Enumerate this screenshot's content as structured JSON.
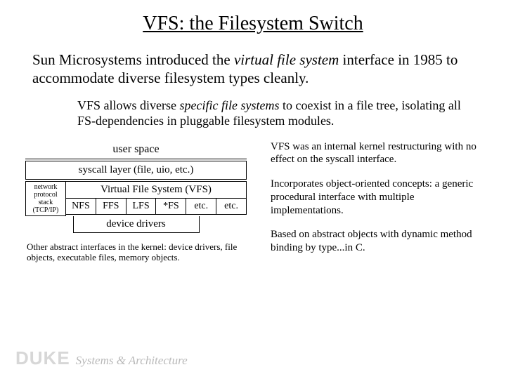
{
  "title": "VFS: the Filesystem Switch",
  "intro_a": "Sun Microsystems introduced the ",
  "intro_em": "virtual file system",
  "intro_b": " interface in 1985 to accommodate diverse filesystem types cleanly.",
  "sub_a": "VFS allows diverse ",
  "sub_em": "specific file systems",
  "sub_b": " to coexist in a file tree, isolating all FS-dependencies in pluggable filesystem modules.",
  "diagram": {
    "user": "user space",
    "syscall": "syscall layer (file, uio, etc.)",
    "net": "network protocol stack (TCP/IP)",
    "vfs": "Virtual File System (VFS)",
    "fs": {
      "nfs": "NFS",
      "ffs": "FFS",
      "lfs": "LFS",
      "xfs": "*FS",
      "etc1": "etc.",
      "etc2": "etc."
    },
    "dev": "device drivers",
    "caption": "Other abstract interfaces in the kernel: device drivers, file objects, executable files, memory objects."
  },
  "right": {
    "p1": "VFS was an internal kernel restructuring with no effect on the syscall interface.",
    "p2": "Incorporates object-oriented concepts: a generic procedural interface with multiple implementations.",
    "p3": "Based on abstract objects with dynamic method binding by type...in C."
  },
  "footer": {
    "duke": "DUKE",
    "sysarch": "Systems & Architecture"
  }
}
